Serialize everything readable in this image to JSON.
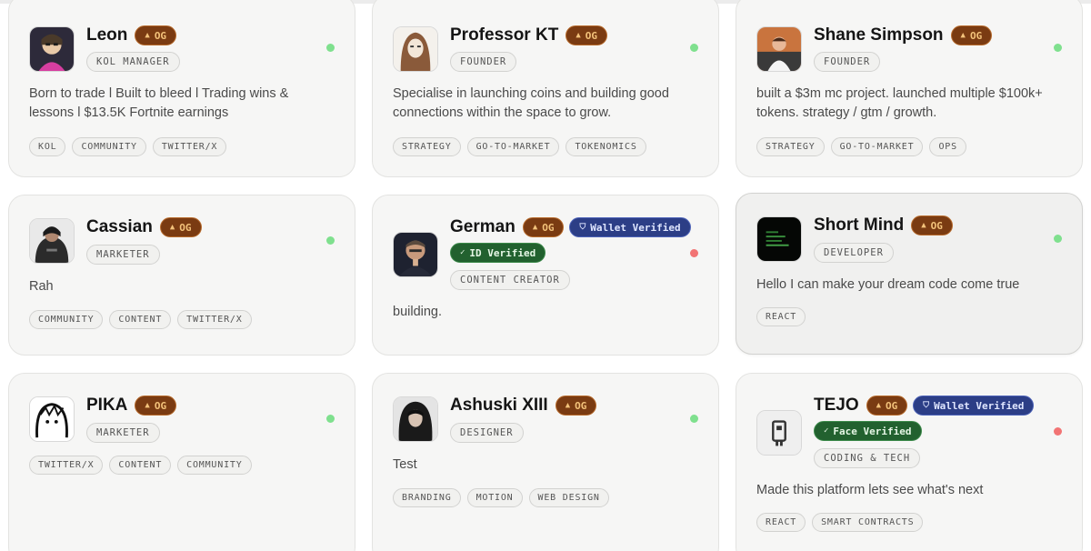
{
  "cards": [
    {
      "name": "Leon",
      "badges": {
        "og": "OG"
      },
      "role": "KOL MANAGER",
      "bio": "Born to trade l Built to bleed l Trading wins & lessons l $13.5K Fortnite earnings",
      "tags": [
        "KOL",
        "COMMUNITY",
        "TWITTER/X"
      ],
      "status": "online"
    },
    {
      "name": "Professor KT",
      "badges": {
        "og": "OG"
      },
      "role": "FOUNDER",
      "bio": "Specialise in launching coins and building good connections within the space to grow.",
      "tags": [
        "STRATEGY",
        "GO-TO-MARKET",
        "TOKENOMICS"
      ],
      "status": "online"
    },
    {
      "name": "Shane Simpson",
      "badges": {
        "og": "OG"
      },
      "role": "FOUNDER",
      "bio": "built a $3m mc project. launched multiple $100k+ tokens. strategy / gtm / growth.",
      "tags": [
        "STRATEGY",
        "GO-TO-MARKET",
        "OPS"
      ],
      "status": "online"
    },
    {
      "name": "Cassian",
      "badges": {
        "og": "OG"
      },
      "role": "MARKETER",
      "bio": "Rah",
      "tags": [
        "COMMUNITY",
        "CONTENT",
        "TWITTER/X"
      ],
      "status": "online"
    },
    {
      "name": "German",
      "badges": {
        "og": "OG",
        "wallet": "Wallet Verified",
        "id": "ID Verified"
      },
      "role": "CONTENT CREATOR",
      "bio": "building.",
      "tags": [],
      "status": "offline"
    },
    {
      "name": "Short Mind",
      "badges": {
        "og": "OG"
      },
      "role": "DEVELOPER",
      "bio": "Hello I can make your dream code come true",
      "tags": [
        "REACT"
      ],
      "status": "online"
    },
    {
      "name": "PIKA",
      "badges": {
        "og": "OG"
      },
      "role": "MARKETER",
      "bio": "",
      "tags": [
        "TWITTER/X",
        "CONTENT",
        "COMMUNITY"
      ],
      "status": "online"
    },
    {
      "name": "Ashuski XIII",
      "badges": {
        "og": "OG"
      },
      "role": "DESIGNER",
      "bio": "Test",
      "tags": [
        "BRANDING",
        "MOTION",
        "WEB DESIGN"
      ],
      "status": "online"
    },
    {
      "name": "TEJO",
      "badges": {
        "og": "OG",
        "wallet": "Wallet Verified",
        "id": "Face Verified"
      },
      "role": "CODING & TECH",
      "bio": "Made this platform lets see what's next",
      "tags": [
        "REACT",
        "SMART CONTRACTS"
      ],
      "status": "offline"
    }
  ],
  "colors": {
    "og_badge": "#7a3b12",
    "wallet_badge": "#2c3e86",
    "id_badge": "#22612f",
    "online": "#7fe08e",
    "offline": "#f27474"
  },
  "icons": {
    "og": "warning-triangle-icon",
    "wallet": "shield-icon",
    "verified": "check-circle-icon",
    "status": "status-dot-icon"
  }
}
